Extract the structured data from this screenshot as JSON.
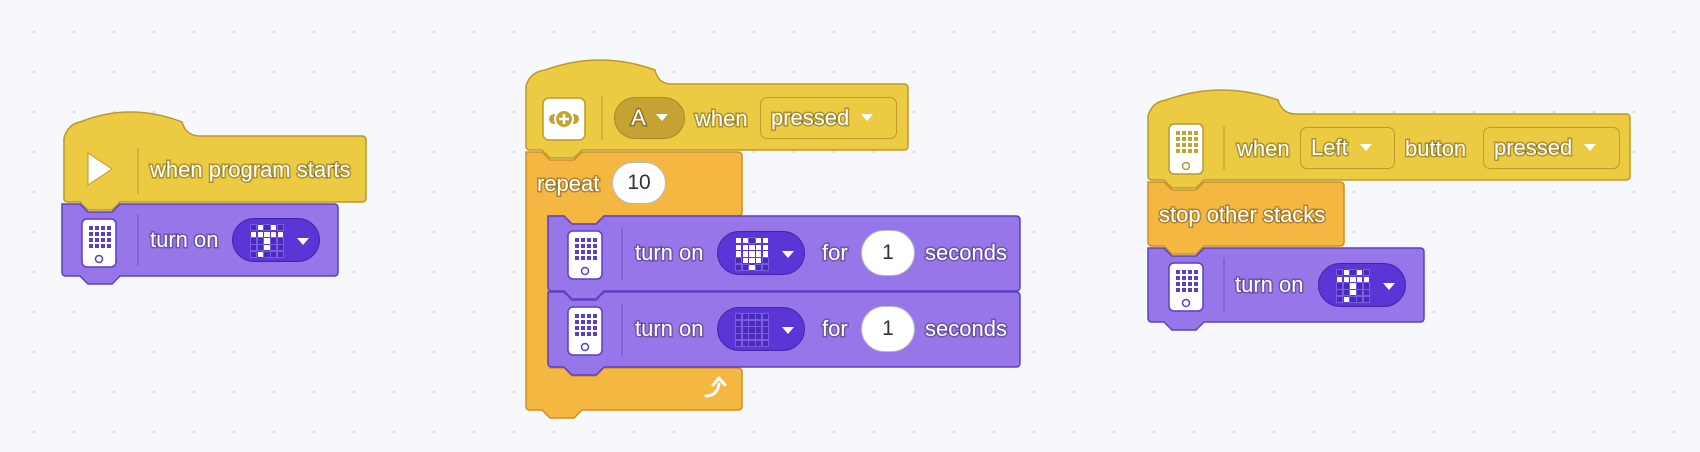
{
  "colors": {
    "event_yellow": "#eccb42",
    "control_orange": "#f4b742",
    "display_purple": "#9776ea",
    "canvas": "#f7f8fb"
  },
  "stack1": {
    "hat_icon": "play-icon",
    "hat_label": "when program starts",
    "turn_on_label": "turn on",
    "matrix_icon": "hub-matrix-icon"
  },
  "stack2": {
    "hat_icon": "remote-button-icon",
    "button_value": "A",
    "when_label": "when",
    "event_value": "pressed",
    "repeat_label": "repeat",
    "repeat_count": "10",
    "row1": {
      "turn_on_label": "turn on",
      "for_label": "for",
      "duration": "1",
      "seconds_label": "seconds"
    },
    "row2": {
      "turn_on_label": "turn on",
      "for_label": "for",
      "duration": "1",
      "seconds_label": "seconds"
    },
    "loop_icon": "loop-arrow-icon"
  },
  "stack3": {
    "hat_icon": "hub-icon",
    "when_label": "when",
    "button_value": "Left",
    "button_label": "button",
    "event_value": "pressed",
    "stop_label": "stop other stacks",
    "turn_on_label": "turn on"
  },
  "matrices": {
    "m1": [
      0,
      1,
      0,
      1,
      0,
      1,
      1,
      1,
      1,
      1,
      0,
      0,
      1,
      0,
      0,
      0,
      0,
      1,
      0,
      0,
      0,
      1,
      0,
      0,
      0
    ],
    "m2": [
      1,
      1,
      0,
      1,
      1,
      1,
      1,
      1,
      1,
      1,
      1,
      1,
      1,
      1,
      1,
      0,
      1,
      1,
      1,
      0,
      0,
      0,
      1,
      0,
      0
    ],
    "m3": [
      0,
      0,
      0,
      0,
      0,
      0,
      0,
      0,
      0,
      0,
      0,
      0,
      0,
      0,
      0,
      0,
      0,
      0,
      0,
      0,
      0,
      0,
      0,
      0,
      0
    ],
    "m4": [
      0,
      1,
      0,
      1,
      0,
      1,
      1,
      1,
      1,
      1,
      0,
      0,
      1,
      0,
      0,
      0,
      0,
      1,
      0,
      0,
      0,
      1,
      0,
      0,
      0
    ]
  }
}
